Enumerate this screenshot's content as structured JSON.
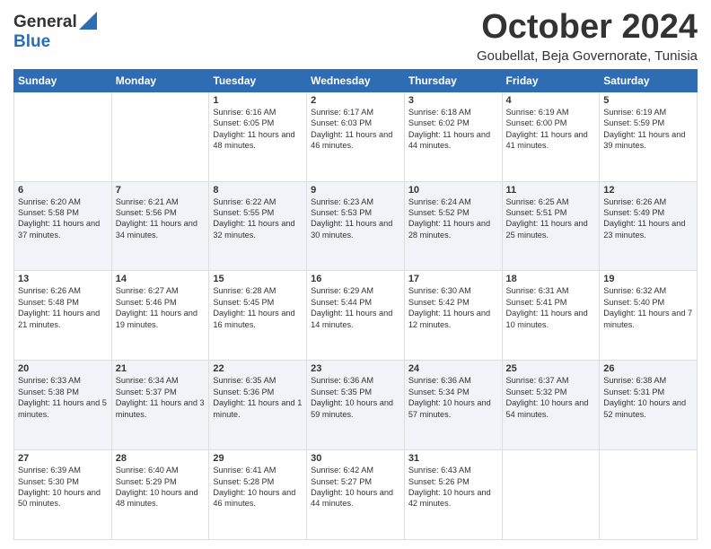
{
  "header": {
    "logo_line1": "General",
    "logo_line2": "Blue",
    "month": "October 2024",
    "location": "Goubellat, Beja Governorate, Tunisia"
  },
  "days_of_week": [
    "Sunday",
    "Monday",
    "Tuesday",
    "Wednesday",
    "Thursday",
    "Friday",
    "Saturday"
  ],
  "weeks": [
    [
      {
        "day": "",
        "sunrise": "",
        "sunset": "",
        "daylight": ""
      },
      {
        "day": "",
        "sunrise": "",
        "sunset": "",
        "daylight": ""
      },
      {
        "day": "1",
        "sunrise": "Sunrise: 6:16 AM",
        "sunset": "Sunset: 6:05 PM",
        "daylight": "Daylight: 11 hours and 48 minutes."
      },
      {
        "day": "2",
        "sunrise": "Sunrise: 6:17 AM",
        "sunset": "Sunset: 6:03 PM",
        "daylight": "Daylight: 11 hours and 46 minutes."
      },
      {
        "day": "3",
        "sunrise": "Sunrise: 6:18 AM",
        "sunset": "Sunset: 6:02 PM",
        "daylight": "Daylight: 11 hours and 44 minutes."
      },
      {
        "day": "4",
        "sunrise": "Sunrise: 6:19 AM",
        "sunset": "Sunset: 6:00 PM",
        "daylight": "Daylight: 11 hours and 41 minutes."
      },
      {
        "day": "5",
        "sunrise": "Sunrise: 6:19 AM",
        "sunset": "Sunset: 5:59 PM",
        "daylight": "Daylight: 11 hours and 39 minutes."
      }
    ],
    [
      {
        "day": "6",
        "sunrise": "Sunrise: 6:20 AM",
        "sunset": "Sunset: 5:58 PM",
        "daylight": "Daylight: 11 hours and 37 minutes."
      },
      {
        "day": "7",
        "sunrise": "Sunrise: 6:21 AM",
        "sunset": "Sunset: 5:56 PM",
        "daylight": "Daylight: 11 hours and 34 minutes."
      },
      {
        "day": "8",
        "sunrise": "Sunrise: 6:22 AM",
        "sunset": "Sunset: 5:55 PM",
        "daylight": "Daylight: 11 hours and 32 minutes."
      },
      {
        "day": "9",
        "sunrise": "Sunrise: 6:23 AM",
        "sunset": "Sunset: 5:53 PM",
        "daylight": "Daylight: 11 hours and 30 minutes."
      },
      {
        "day": "10",
        "sunrise": "Sunrise: 6:24 AM",
        "sunset": "Sunset: 5:52 PM",
        "daylight": "Daylight: 11 hours and 28 minutes."
      },
      {
        "day": "11",
        "sunrise": "Sunrise: 6:25 AM",
        "sunset": "Sunset: 5:51 PM",
        "daylight": "Daylight: 11 hours and 25 minutes."
      },
      {
        "day": "12",
        "sunrise": "Sunrise: 6:26 AM",
        "sunset": "Sunset: 5:49 PM",
        "daylight": "Daylight: 11 hours and 23 minutes."
      }
    ],
    [
      {
        "day": "13",
        "sunrise": "Sunrise: 6:26 AM",
        "sunset": "Sunset: 5:48 PM",
        "daylight": "Daylight: 11 hours and 21 minutes."
      },
      {
        "day": "14",
        "sunrise": "Sunrise: 6:27 AM",
        "sunset": "Sunset: 5:46 PM",
        "daylight": "Daylight: 11 hours and 19 minutes."
      },
      {
        "day": "15",
        "sunrise": "Sunrise: 6:28 AM",
        "sunset": "Sunset: 5:45 PM",
        "daylight": "Daylight: 11 hours and 16 minutes."
      },
      {
        "day": "16",
        "sunrise": "Sunrise: 6:29 AM",
        "sunset": "Sunset: 5:44 PM",
        "daylight": "Daylight: 11 hours and 14 minutes."
      },
      {
        "day": "17",
        "sunrise": "Sunrise: 6:30 AM",
        "sunset": "Sunset: 5:42 PM",
        "daylight": "Daylight: 11 hours and 12 minutes."
      },
      {
        "day": "18",
        "sunrise": "Sunrise: 6:31 AM",
        "sunset": "Sunset: 5:41 PM",
        "daylight": "Daylight: 11 hours and 10 minutes."
      },
      {
        "day": "19",
        "sunrise": "Sunrise: 6:32 AM",
        "sunset": "Sunset: 5:40 PM",
        "daylight": "Daylight: 11 hours and 7 minutes."
      }
    ],
    [
      {
        "day": "20",
        "sunrise": "Sunrise: 6:33 AM",
        "sunset": "Sunset: 5:38 PM",
        "daylight": "Daylight: 11 hours and 5 minutes."
      },
      {
        "day": "21",
        "sunrise": "Sunrise: 6:34 AM",
        "sunset": "Sunset: 5:37 PM",
        "daylight": "Daylight: 11 hours and 3 minutes."
      },
      {
        "day": "22",
        "sunrise": "Sunrise: 6:35 AM",
        "sunset": "Sunset: 5:36 PM",
        "daylight": "Daylight: 11 hours and 1 minute."
      },
      {
        "day": "23",
        "sunrise": "Sunrise: 6:36 AM",
        "sunset": "Sunset: 5:35 PM",
        "daylight": "Daylight: 10 hours and 59 minutes."
      },
      {
        "day": "24",
        "sunrise": "Sunrise: 6:36 AM",
        "sunset": "Sunset: 5:34 PM",
        "daylight": "Daylight: 10 hours and 57 minutes."
      },
      {
        "day": "25",
        "sunrise": "Sunrise: 6:37 AM",
        "sunset": "Sunset: 5:32 PM",
        "daylight": "Daylight: 10 hours and 54 minutes."
      },
      {
        "day": "26",
        "sunrise": "Sunrise: 6:38 AM",
        "sunset": "Sunset: 5:31 PM",
        "daylight": "Daylight: 10 hours and 52 minutes."
      }
    ],
    [
      {
        "day": "27",
        "sunrise": "Sunrise: 6:39 AM",
        "sunset": "Sunset: 5:30 PM",
        "daylight": "Daylight: 10 hours and 50 minutes."
      },
      {
        "day": "28",
        "sunrise": "Sunrise: 6:40 AM",
        "sunset": "Sunset: 5:29 PM",
        "daylight": "Daylight: 10 hours and 48 minutes."
      },
      {
        "day": "29",
        "sunrise": "Sunrise: 6:41 AM",
        "sunset": "Sunset: 5:28 PM",
        "daylight": "Daylight: 10 hours and 46 minutes."
      },
      {
        "day": "30",
        "sunrise": "Sunrise: 6:42 AM",
        "sunset": "Sunset: 5:27 PM",
        "daylight": "Daylight: 10 hours and 44 minutes."
      },
      {
        "day": "31",
        "sunrise": "Sunrise: 6:43 AM",
        "sunset": "Sunset: 5:26 PM",
        "daylight": "Daylight: 10 hours and 42 minutes."
      },
      {
        "day": "",
        "sunrise": "",
        "sunset": "",
        "daylight": ""
      },
      {
        "day": "",
        "sunrise": "",
        "sunset": "",
        "daylight": ""
      }
    ]
  ]
}
